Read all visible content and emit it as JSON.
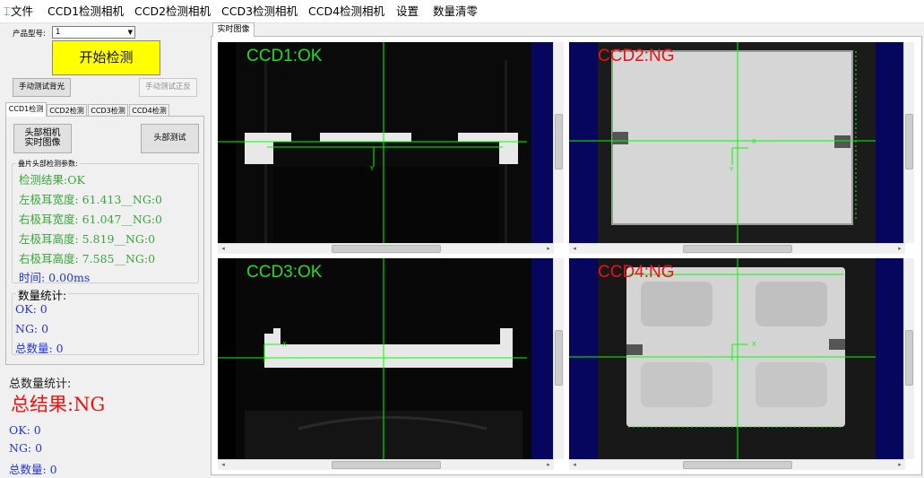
{
  "menu": {
    "items": [
      "文件",
      "CCD1检测相机",
      "CCD2检测相机",
      "CCD3检测相机",
      "CCD4检测相机",
      "设置",
      "数量清零"
    ]
  },
  "left": {
    "product_label": "产品型号:",
    "product_value": "1",
    "start_button": "开始检测",
    "manual_back_button": "手动测试背光",
    "manual_front_button": "手动测试正反",
    "tabs": [
      "CCD1检测",
      "CCD2检测",
      "CCD3检测",
      "CCD4检测"
    ],
    "head_camera_button": "头部相机\n实时图像",
    "head_test_button": "头部测试",
    "params_group_title": "叠片头部检测参数:",
    "results": {
      "result": "检测结果:OK",
      "left_tab_width": "左极耳宽度:  61.413__NG:0",
      "right_tab_width": "右极耳宽度:  61.047__NG:0",
      "left_tab_height": "左极耳高度:  5.819__NG:0",
      "right_tab_height": "右极耳高度:  7.585__NG:0",
      "time": "时间:  0.00ms"
    },
    "count_group_title": "数量统计:",
    "counts": {
      "ok": "OK:  0",
      "ng": "NG:  0",
      "total": "总数量:  0"
    },
    "total_title": "总数量统计:",
    "total_result": "总结果:NG",
    "total_counts": {
      "ok": "OK:  0",
      "ng": "NG:  0",
      "total": "总数量:  0"
    }
  },
  "right": {
    "tab": "实时图像",
    "viewers": [
      {
        "label": "CCD1:OK",
        "color": "#22dd22"
      },
      {
        "label": "CCD2:NG",
        "color": "#ee1111"
      },
      {
        "label": "CCD3:OK",
        "color": "#22dd22"
      },
      {
        "label": "CCD4:NG",
        "color": "#ee1111"
      }
    ]
  },
  "colors": {
    "start_button_bg": "#ffff00",
    "green_text": "#3aa63a",
    "blue_text": "#2233dd",
    "red_text": "#ee1111",
    "navy": "#06065e",
    "overlay_green": "#00ff00"
  }
}
